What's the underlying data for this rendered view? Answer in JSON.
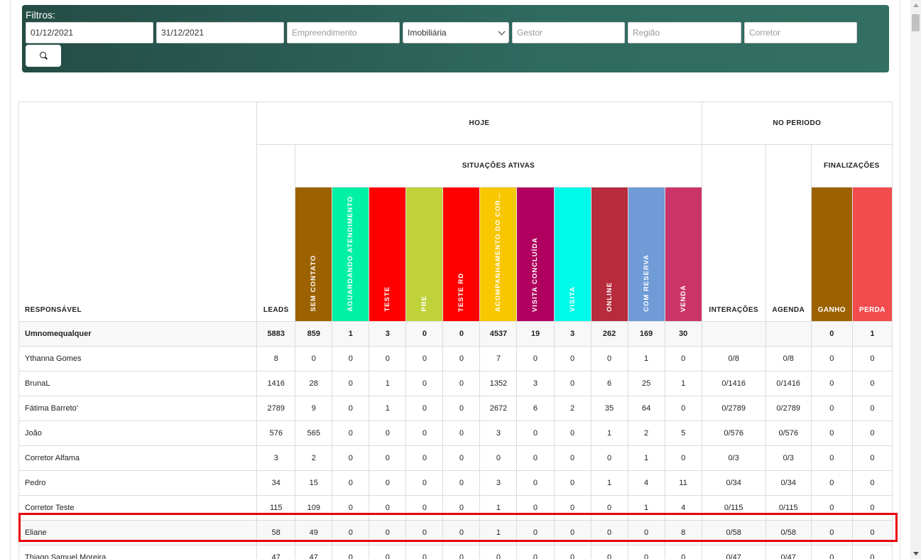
{
  "filters": {
    "title": "Filtros:",
    "date_start": "01/12/2021",
    "date_end": "31/12/2021",
    "empreendimento_placeholder": "Empreendimento",
    "imobiliaria_selected": "Imobiliária",
    "gestor_placeholder": "Gestor",
    "regiao_placeholder": "Região",
    "corretor_placeholder": "Corretor",
    "search_icon": "search-icon"
  },
  "table": {
    "header": {
      "responsavel": "RESPONSÁVEL",
      "hoje": "HOJE",
      "no_periodo": "NO PERIODO",
      "leads": "LEADS",
      "situacoes_ativas": "SITUAÇÕES ATIVAS",
      "interacoes": "INTERAÇÕES",
      "agenda": "AGENDA",
      "finalizacoes": "FINALIZAÇÕES"
    },
    "status_columns": [
      {
        "label": "SEM CONTATO",
        "color": "#9c6100"
      },
      {
        "label": "AGUARDANDO ATENDIMENTO",
        "color": "#00f0a4"
      },
      {
        "label": "TESTE",
        "color": "#ff0000"
      },
      {
        "label": "PRE",
        "color": "#c0d23a"
      },
      {
        "label": "TESTE RD",
        "color": "#ff0000"
      },
      {
        "label": "ACOMPANHAMENTO DO CORRETOR",
        "color": "#f8c700"
      },
      {
        "label": "VISITA CONCLUÍDA",
        "color": "#b0005f"
      },
      {
        "label": "VISITA",
        "color": "#00f9e8"
      },
      {
        "label": "ONLINE",
        "color": "#b72b3c"
      },
      {
        "label": "COM RESERVA",
        "color": "#6f9bd6"
      },
      {
        "label": "VENDA",
        "color": "#cb3466"
      }
    ],
    "final_columns": [
      {
        "label": "GANHO",
        "color": "#9c6100"
      },
      {
        "label": "PERDA",
        "color": "#f24c4c"
      }
    ],
    "total_row": {
      "name": "Umnomequalquer",
      "leads": "5883",
      "status": [
        "859",
        "1",
        "3",
        "0",
        "0",
        "4537",
        "19",
        "3",
        "262",
        "169",
        "30"
      ],
      "interacoes": "",
      "agenda": "",
      "ganho": "0",
      "perda": "1"
    },
    "rows": [
      {
        "name": "Ythanna Gomes",
        "leads": "8",
        "status": [
          "0",
          "0",
          "0",
          "0",
          "0",
          "7",
          "0",
          "0",
          "0",
          "1",
          "0"
        ],
        "interacoes": "0/8",
        "agenda": "0/8",
        "ganho": "0",
        "perda": "0"
      },
      {
        "name": "BrunaL",
        "leads": "1416",
        "status": [
          "28",
          "0",
          "1",
          "0",
          "0",
          "1352",
          "3",
          "0",
          "6",
          "25",
          "1"
        ],
        "interacoes": "0/1416",
        "agenda": "0/1416",
        "ganho": "0",
        "perda": "0"
      },
      {
        "name": "Fátima Barreto'",
        "leads": "2789",
        "status": [
          "9",
          "0",
          "1",
          "0",
          "0",
          "2672",
          "6",
          "2",
          "35",
          "64",
          "0"
        ],
        "interacoes": "0/2789",
        "agenda": "0/2789",
        "ganho": "0",
        "perda": "0"
      },
      {
        "name": "João",
        "leads": "576",
        "status": [
          "565",
          "0",
          "0",
          "0",
          "0",
          "3",
          "0",
          "0",
          "1",
          "2",
          "5"
        ],
        "interacoes": "0/576",
        "agenda": "0/576",
        "ganho": "0",
        "perda": "0"
      },
      {
        "name": "Corretor Alfama",
        "leads": "3",
        "status": [
          "2",
          "0",
          "0",
          "0",
          "0",
          "0",
          "0",
          "0",
          "0",
          "1",
          "0"
        ],
        "interacoes": "0/3",
        "agenda": "0/3",
        "ganho": "0",
        "perda": "0"
      },
      {
        "name": "Pedro",
        "leads": "34",
        "status": [
          "15",
          "0",
          "0",
          "0",
          "0",
          "3",
          "0",
          "0",
          "1",
          "4",
          "11"
        ],
        "interacoes": "0/34",
        "agenda": "0/34",
        "ganho": "0",
        "perda": "0"
      },
      {
        "name": "Corretor Teste",
        "leads": "115",
        "status": [
          "109",
          "0",
          "0",
          "0",
          "0",
          "1",
          "0",
          "0",
          "0",
          "1",
          "4"
        ],
        "interacoes": "0/115",
        "agenda": "0/115",
        "ganho": "0",
        "perda": "0"
      },
      {
        "name": "Eliane",
        "leads": "58",
        "status": [
          "49",
          "0",
          "0",
          "0",
          "0",
          "1",
          "0",
          "0",
          "0",
          "0",
          "8"
        ],
        "interacoes": "0/58",
        "agenda": "0/58",
        "ganho": "0",
        "perda": "0"
      },
      {
        "name": "Thiago Samuel Moreira",
        "leads": "47",
        "status": [
          "47",
          "0",
          "0",
          "0",
          "0",
          "0",
          "0",
          "0",
          "0",
          "0",
          "0"
        ],
        "interacoes": "0/47",
        "agenda": "0/47",
        "ganho": "0",
        "perda": "0"
      }
    ]
  }
}
